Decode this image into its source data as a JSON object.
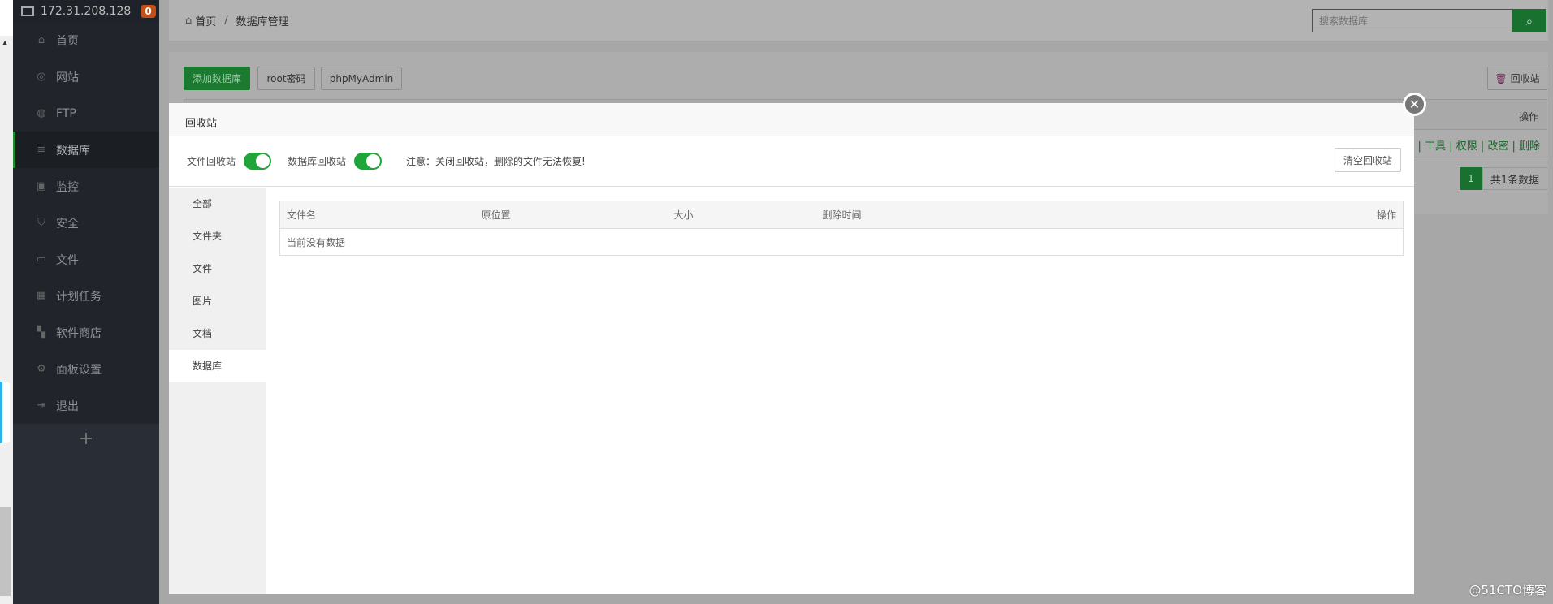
{
  "sidebar": {
    "host": "172.31.208.128",
    "badge": "0",
    "add": "+",
    "items": [
      {
        "label": "首页",
        "icon": "⌂"
      },
      {
        "label": "网站",
        "icon": "◎"
      },
      {
        "label": "FTP",
        "icon": "◍"
      },
      {
        "label": "数据库",
        "icon": "≡"
      },
      {
        "label": "监控",
        "icon": "▣"
      },
      {
        "label": "安全",
        "icon": "⛉"
      },
      {
        "label": "文件",
        "icon": "▭"
      },
      {
        "label": "计划任务",
        "icon": "▦"
      },
      {
        "label": "软件商店",
        "icon": "▚"
      },
      {
        "label": "面板设置",
        "icon": "⚙"
      },
      {
        "label": "退出",
        "icon": "⇥"
      }
    ]
  },
  "breadcrumb": {
    "home": "首页",
    "sep": "/",
    "current": "数据库管理"
  },
  "search": {
    "placeholder": "搜索数据库"
  },
  "toolbar": {
    "add": "添加数据库",
    "root": "root密码",
    "pma": "phpMyAdmin",
    "recycle": "回收站"
  },
  "bg_table": {
    "header_action": "操作",
    "row_actions": "管理 | 工具 | 权限 | 改密 | 删除"
  },
  "pagination": {
    "page": "1",
    "total": "共1条数据"
  },
  "modal": {
    "title": "回收站",
    "file_recycle_label": "文件回收站",
    "db_recycle_label": "数据库回收站",
    "file_recycle_on": true,
    "db_recycle_on": true,
    "note": "注意：关闭回收站，删除的文件无法恢复!",
    "clear": "清空回收站",
    "tabs": [
      "全部",
      "文件夹",
      "文件",
      "图片",
      "文档",
      "数据库"
    ],
    "active_tab": "数据库",
    "columns": [
      "文件名",
      "原位置",
      "大小",
      "删除时间",
      "操作"
    ],
    "empty": "当前没有数据"
  },
  "watermark": "@51CTO博客"
}
